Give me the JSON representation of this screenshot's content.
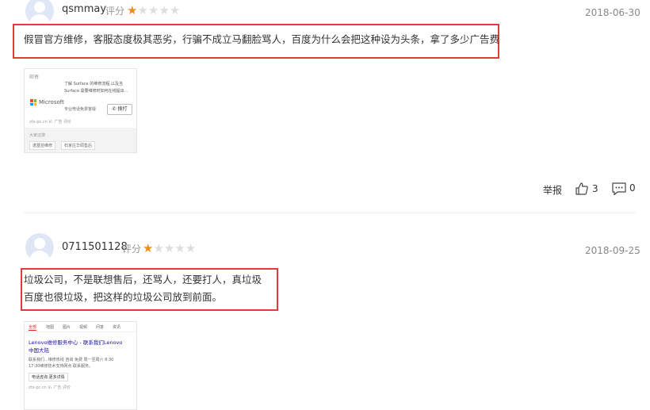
{
  "comments": [
    {
      "username": "qsmmay",
      "rating_label": "评分",
      "rating": 1,
      "rating_max": 5,
      "date": "2018-06-30",
      "text_lines": [
        "假冒官方维修，客服态度极其恶劣，行骗不成立马翻脸骂人，百度为什么会把这种设为头条，拿了多少广告费"
      ],
      "thumbnail": {
        "header": "邮寄",
        "desc_line1": "了解 Surface 的维修流程,以及当",
        "desc_line2": "Surface 需要维修时如何在线提出...",
        "brand": "Microsoft",
        "sub": "专业电话免费答疑",
        "call_btn": "拨打",
        "meta": "ztx-pc.cn  V₁  广告  评价",
        "search_label": "大家还搜",
        "tags": [
          "诺基亚维修",
          "石家庄华硕售后"
        ]
      },
      "actions": {
        "report": "举报",
        "likes": "3",
        "comments": "0"
      }
    },
    {
      "username": "0711501128",
      "rating_label": "评分",
      "rating": 1,
      "rating_max": 5,
      "date": "2018-09-25",
      "text_lines": [
        "垃圾公司，不是联想售后，还骂人，还要打人，真垃圾",
        "百度也很垃圾，把这样的垃圾公司放到前面。"
      ],
      "thumbnail": {
        "tabs": [
          "全部",
          "地图",
          "图片",
          "视频",
          "问答",
          "资讯"
        ],
        "title_line1": "Lenovo维修服务中心 - 联系我们Lenovo",
        "title_line2": "中国大陆",
        "desc_line1": "联系我们...维修热线 咨询 免费 周一至周六 8:30",
        "desc_line2": "17:30维修技术支持网点 联系服务。",
        "btn_label": "电话咨询  更多详情",
        "meta": "ztx-pc.cn  V₁  广告  评价"
      }
    }
  ],
  "colors": {
    "star_on": "#f18a1c",
    "star_off": "#dddddd",
    "highlight_box": "#e23b3b",
    "link_red": "#d8271c"
  }
}
